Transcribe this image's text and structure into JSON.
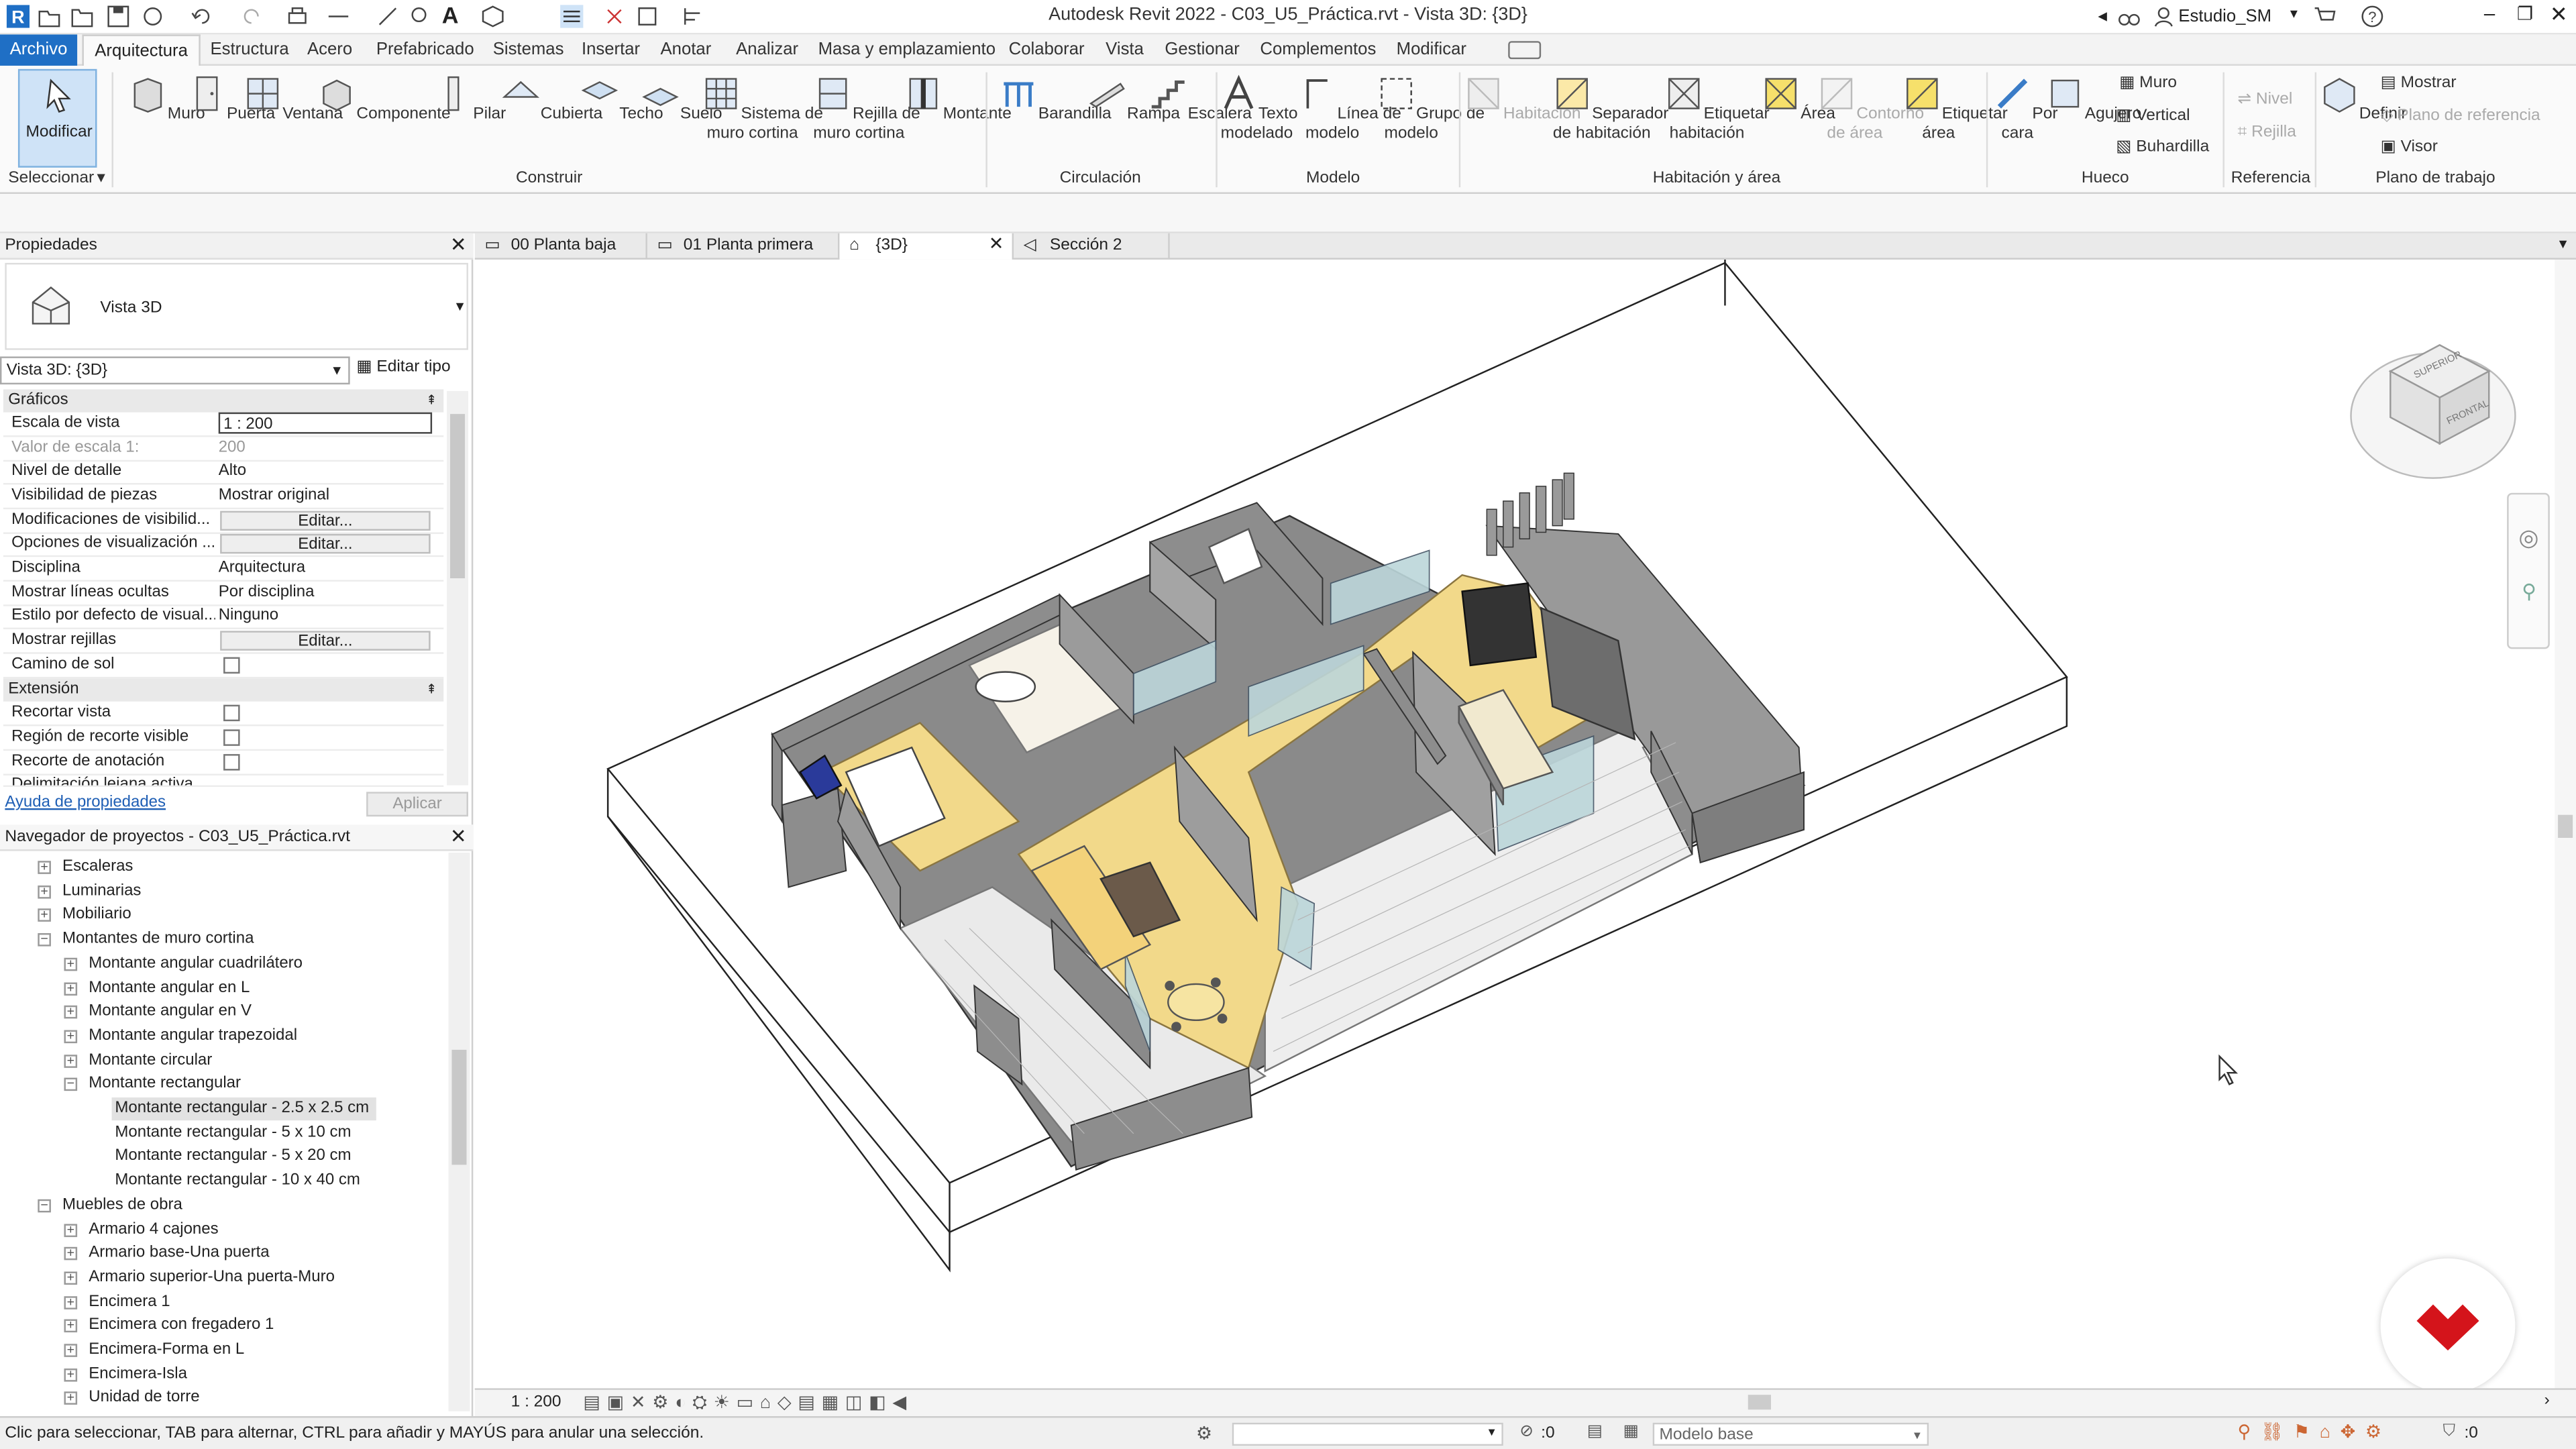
{
  "window": {
    "title": "Autodesk Revit 2022 - C03_U5_Práctica.rvt - Vista 3D: {3D}",
    "user": "Estudio_SM"
  },
  "menu": {
    "tabs": [
      "Archivo",
      "Arquitectura",
      "Estructura",
      "Acero",
      "Prefabricado",
      "Sistemas",
      "Insertar",
      "Anotar",
      "Analizar",
      "Masa y emplazamiento",
      "Colaborar",
      "Vista",
      "Gestionar",
      "Complementos",
      "Modificar"
    ]
  },
  "ribbon": {
    "seleccionar": "Seleccionar",
    "modificar": "Modificar",
    "construir": {
      "label": "Construir",
      "tools": [
        "Muro",
        "Puerta",
        "Ventana",
        "Componente",
        "Pilar",
        "Cubierta",
        "Techo",
        "Suelo",
        "Sistema de",
        "muro cortina",
        "Rejilla de",
        "muro cortina",
        "Montante"
      ]
    },
    "circulacion": {
      "label": "Circulación",
      "tools": [
        "Barandilla",
        "Rampa",
        "Escalera"
      ]
    },
    "modelo": {
      "label": "Modelo",
      "tools": [
        "Texto",
        "modelado",
        "Línea de",
        "modelo",
        "Grupo de",
        "modelo"
      ]
    },
    "habitacion": {
      "label": "Habitación y área",
      "tools": [
        "Habitación",
        "Separador",
        "de habitación",
        "Etiquetar",
        "habitación",
        "Área",
        "Contorno",
        "de área",
        "Etiquetar",
        "área"
      ]
    },
    "hueco": {
      "label": "Hueco",
      "tools": [
        "Por",
        "cara",
        "Agujero",
        "Muro",
        "Vertical",
        "Buhardilla"
      ]
    },
    "referencia": {
      "label": "Referencia",
      "tools": [
        "Nivel",
        "Rejilla"
      ]
    },
    "plano": {
      "label": "Plano de trabajo",
      "tools": [
        "Definir",
        "Mostrar",
        "Plano de referencia",
        "Visor"
      ]
    }
  },
  "properties": {
    "title": "Propiedades",
    "type_name": "Vista 3D",
    "selector": "Vista 3D: {3D}",
    "edit_type": "Editar tipo",
    "sections": [
      "Gráficos",
      "Extensión"
    ],
    "rows": [
      {
        "k": "Escala de vista",
        "v": "1 : 200"
      },
      {
        "k": "Valor de escala    1:",
        "v": "200"
      },
      {
        "k": "Nivel de detalle",
        "v": "Alto"
      },
      {
        "k": "Visibilidad de piezas",
        "v": "Mostrar original"
      },
      {
        "k": "Modificaciones de visibilid...",
        "v": "Editar..."
      },
      {
        "k": "Opciones de visualización ...",
        "v": "Editar..."
      },
      {
        "k": "Disciplina",
        "v": "Arquitectura"
      },
      {
        "k": "Mostrar líneas ocultas",
        "v": "Por disciplina"
      },
      {
        "k": "Estilo por defecto de visual...",
        "v": "Ninguno"
      },
      {
        "k": "Mostrar rejillas",
        "v": "Editar..."
      },
      {
        "k": "Camino de sol",
        "v": ""
      },
      {
        "k": "Recortar vista",
        "v": ""
      },
      {
        "k": "Región de recorte visible",
        "v": ""
      },
      {
        "k": "Recorte de anotación",
        "v": ""
      },
      {
        "k": "Delimitación lejana activa",
        "v": ""
      }
    ],
    "help_link": "Ayuda de propiedades",
    "apply": "Aplicar"
  },
  "browser": {
    "title": "Navegador de proyectos - C03_U5_Práctica.rvt",
    "items": [
      {
        "label": "Escaleras",
        "level": 1,
        "tw": "+"
      },
      {
        "label": "Luminarias",
        "level": 1,
        "tw": "+"
      },
      {
        "label": "Mobiliario",
        "level": 1,
        "tw": "+"
      },
      {
        "label": "Montantes de muro cortina",
        "level": 1,
        "tw": "-"
      },
      {
        "label": "Montante angular cuadrilátero",
        "level": 2,
        "tw": "+"
      },
      {
        "label": "Montante angular en L",
        "level": 2,
        "tw": "+"
      },
      {
        "label": "Montante angular en V",
        "level": 2,
        "tw": "+"
      },
      {
        "label": "Montante angular trapezoidal",
        "level": 2,
        "tw": "+"
      },
      {
        "label": "Montante circular",
        "level": 2,
        "tw": "+"
      },
      {
        "label": "Montante rectangular",
        "level": 2,
        "tw": "-"
      },
      {
        "label": "Montante rectangular - 2.5 x 2.5 cm",
        "level": 3,
        "tw": ""
      },
      {
        "label": "Montante rectangular - 5 x 10 cm",
        "level": 3,
        "tw": ""
      },
      {
        "label": "Montante rectangular - 5 x 20 cm",
        "level": 3,
        "tw": ""
      },
      {
        "label": "Montante rectangular - 10 x 40 cm",
        "level": 3,
        "tw": ""
      },
      {
        "label": "Muebles de obra",
        "level": 1,
        "tw": "-"
      },
      {
        "label": "Armario 4 cajones",
        "level": 2,
        "tw": "+"
      },
      {
        "label": "Armario base-Una puerta",
        "level": 2,
        "tw": "+"
      },
      {
        "label": "Armario superior-Una puerta-Muro",
        "level": 2,
        "tw": "+"
      },
      {
        "label": "Encimera 1",
        "level": 2,
        "tw": "+"
      },
      {
        "label": "Encimera con fregadero 1",
        "level": 2,
        "tw": "+"
      },
      {
        "label": "Encimera-Forma en L",
        "level": 2,
        "tw": "+"
      },
      {
        "label": "Encimera-Isla",
        "level": 2,
        "tw": "+"
      },
      {
        "label": "Unidad de torre",
        "level": 2,
        "tw": "+"
      }
    ]
  },
  "viewtabs": [
    "00 Planta baja",
    "01 Planta primera",
    "{3D}",
    "Sección 2"
  ],
  "viewcube": {
    "top": "SUPERIOR",
    "front": "FRONTAL"
  },
  "viewcontrol": {
    "scale": "1 : 200"
  },
  "status": {
    "hint": "Clic para seleccionar, TAB para alternar, CTRL para añadir y MAYÚS para anular una selección.",
    "model": "Modelo base",
    "count_a": ":0",
    "count_b": ":0"
  },
  "colors": {
    "accent": "#1f6fc5",
    "floor": "#f2d98a",
    "wall": "#8d8d8d",
    "logo": "#d4141b"
  }
}
